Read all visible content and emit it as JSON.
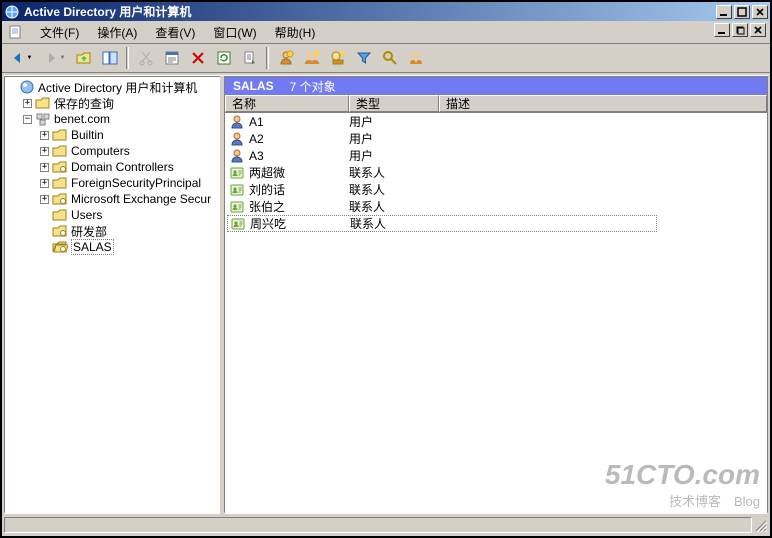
{
  "window": {
    "title": "Active Directory 用户和计算机"
  },
  "menu": {
    "file": "文件(F)",
    "action": "操作(A)",
    "view": "查看(V)",
    "window": "窗口(W)",
    "help": "帮助(H)"
  },
  "tree": {
    "root": "Active Directory 用户和计算机",
    "savedQueries": "保存的查询",
    "domain": "benet.com",
    "children": [
      "Builtin",
      "Computers",
      "Domain Controllers",
      "ForeignSecurityPrincipal",
      "Microsoft Exchange Secur",
      "Users",
      "研发部",
      "SALAS"
    ]
  },
  "list": {
    "headerName": "SALAS",
    "headerCount": "7 个对象",
    "columns": {
      "name": "名称",
      "type": "类型",
      "desc": "描述"
    },
    "rows": [
      {
        "name": "A1",
        "type": "用户",
        "kind": "user"
      },
      {
        "name": "A2",
        "type": "用户",
        "kind": "user"
      },
      {
        "name": "A3",
        "type": "用户",
        "kind": "user"
      },
      {
        "name": "两超微",
        "type": "联系人",
        "kind": "contact"
      },
      {
        "name": "刘的话",
        "type": "联系人",
        "kind": "contact"
      },
      {
        "name": "张伯之",
        "type": "联系人",
        "kind": "contact"
      },
      {
        "name": "周兴吃",
        "type": "联系人",
        "kind": "contact"
      }
    ]
  },
  "watermark": {
    "line1": "51CTO.com",
    "line2": "技术博客　Blog"
  }
}
